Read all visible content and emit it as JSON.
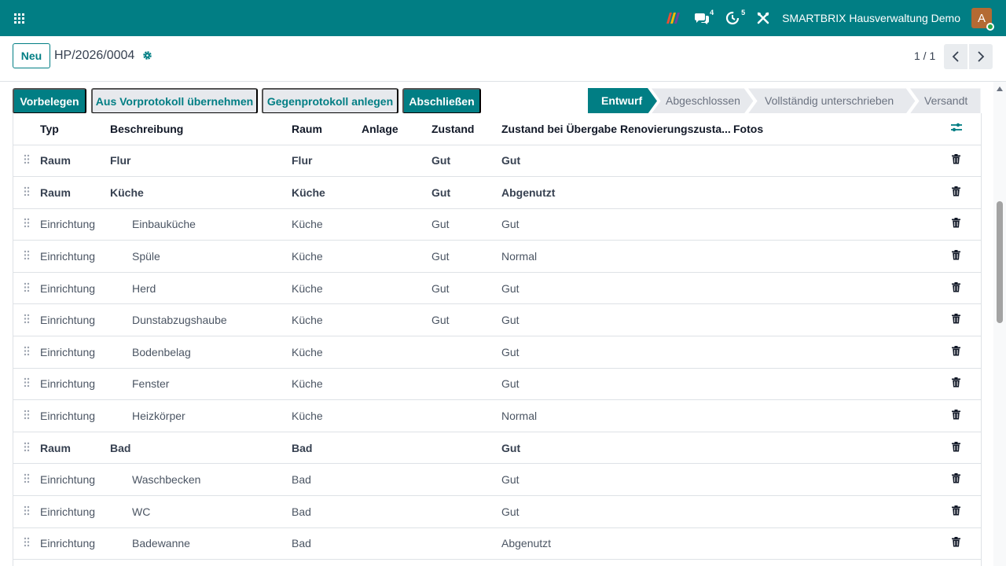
{
  "navbar": {
    "chat_count": "4",
    "activity_count": "5",
    "company": "SMARTBRIX Hausverwaltung Demo",
    "avatar_letter": "A",
    "accent": "#017e84"
  },
  "control": {
    "new_label": "Neu",
    "record_title": "HP/2026/0004",
    "pager": "1 / 1"
  },
  "actions": {
    "vorbelegen": "Vorbelegen",
    "aus_vorprotokoll": "Aus Vorprotokoll übernehmen",
    "gegenprotokoll": "Gegenprotokoll anlegen",
    "abschliessen": "Abschließen"
  },
  "stages": [
    {
      "label": "Entwurf",
      "active": true
    },
    {
      "label": "Abgeschlossen",
      "active": false
    },
    {
      "label": "Vollständig unterschrieben",
      "active": false
    },
    {
      "label": "Versandt",
      "active": false
    }
  ],
  "table": {
    "columns": {
      "typ": "Typ",
      "beschreibung": "Beschreibung",
      "raum": "Raum",
      "anlage": "Anlage",
      "zustand": "Zustand",
      "zustand_uebergabe": "Zustand bei Übergabe",
      "renovierung": "Renovierungszusta...",
      "fotos": "Fotos"
    },
    "rows": [
      {
        "typ": "Raum",
        "beschreibung": "Flur",
        "raum": "Flur",
        "anlage": "",
        "zustand": "Gut",
        "zustand_uebergabe": "Gut",
        "kind": "room"
      },
      {
        "typ": "Raum",
        "beschreibung": "Küche",
        "raum": "Küche",
        "anlage": "",
        "zustand": "Gut",
        "zustand_uebergabe": "Abgenutzt",
        "kind": "room"
      },
      {
        "typ": "Einrichtung",
        "beschreibung": "Einbauküche",
        "raum": "Küche",
        "anlage": "",
        "zustand": "Gut",
        "zustand_uebergabe": "Gut",
        "kind": "item"
      },
      {
        "typ": "Einrichtung",
        "beschreibung": "Spüle",
        "raum": "Küche",
        "anlage": "",
        "zustand": "Gut",
        "zustand_uebergabe": "Normal",
        "kind": "item"
      },
      {
        "typ": "Einrichtung",
        "beschreibung": "Herd",
        "raum": "Küche",
        "anlage": "",
        "zustand": "Gut",
        "zustand_uebergabe": "Gut",
        "kind": "item"
      },
      {
        "typ": "Einrichtung",
        "beschreibung": "Dunstabzugshaube",
        "raum": "Küche",
        "anlage": "",
        "zustand": "Gut",
        "zustand_uebergabe": "Gut",
        "kind": "item"
      },
      {
        "typ": "Einrichtung",
        "beschreibung": "Bodenbelag",
        "raum": "Küche",
        "anlage": "",
        "zustand": "",
        "zustand_uebergabe": "Gut",
        "kind": "item"
      },
      {
        "typ": "Einrichtung",
        "beschreibung": "Fenster",
        "raum": "Küche",
        "anlage": "",
        "zustand": "",
        "zustand_uebergabe": "Gut",
        "kind": "item"
      },
      {
        "typ": "Einrichtung",
        "beschreibung": "Heizkörper",
        "raum": "Küche",
        "anlage": "",
        "zustand": "",
        "zustand_uebergabe": "Normal",
        "kind": "item"
      },
      {
        "typ": "Raum",
        "beschreibung": "Bad",
        "raum": "Bad",
        "anlage": "",
        "zustand": "",
        "zustand_uebergabe": "Gut",
        "kind": "room"
      },
      {
        "typ": "Einrichtung",
        "beschreibung": "Waschbecken",
        "raum": "Bad",
        "anlage": "",
        "zustand": "",
        "zustand_uebergabe": "Gut",
        "kind": "item"
      },
      {
        "typ": "Einrichtung",
        "beschreibung": "WC",
        "raum": "Bad",
        "anlage": "",
        "zustand": "",
        "zustand_uebergabe": "Gut",
        "kind": "item"
      },
      {
        "typ": "Einrichtung",
        "beschreibung": "Badewanne",
        "raum": "Bad",
        "anlage": "",
        "zustand": "",
        "zustand_uebergabe": "Abgenutzt",
        "kind": "item"
      },
      {
        "typ": "",
        "beschreibung": "",
        "raum": "",
        "anlage": "",
        "zustand": "",
        "zustand_uebergabe": "",
        "kind": "item"
      }
    ]
  }
}
